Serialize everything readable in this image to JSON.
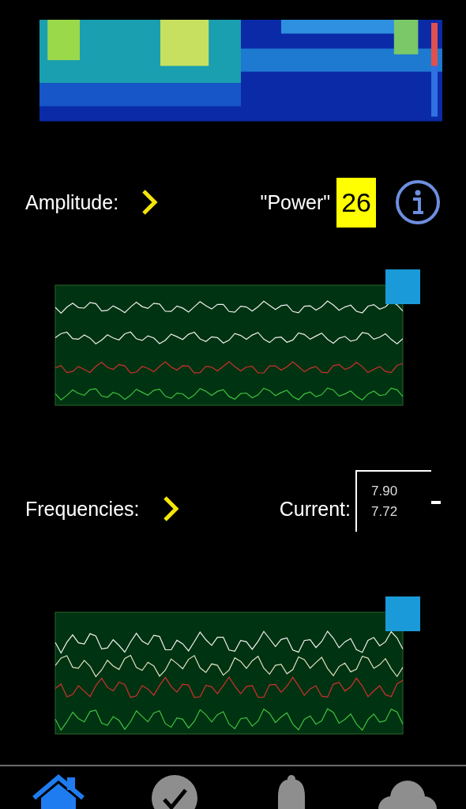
{
  "amplitude": {
    "label": "Amplitude:",
    "power_label": "\"Power\"",
    "power_value": "26"
  },
  "frequencies": {
    "label": "Frequencies:",
    "current_label": "Current:",
    "current_values": [
      "7.90",
      "7.72"
    ]
  },
  "nav": [
    {
      "kind": "home",
      "selected": true
    },
    {
      "kind": "check",
      "selected": false
    },
    {
      "kind": "bell",
      "selected": false
    },
    {
      "kind": "cloud",
      "selected": false
    }
  ]
}
